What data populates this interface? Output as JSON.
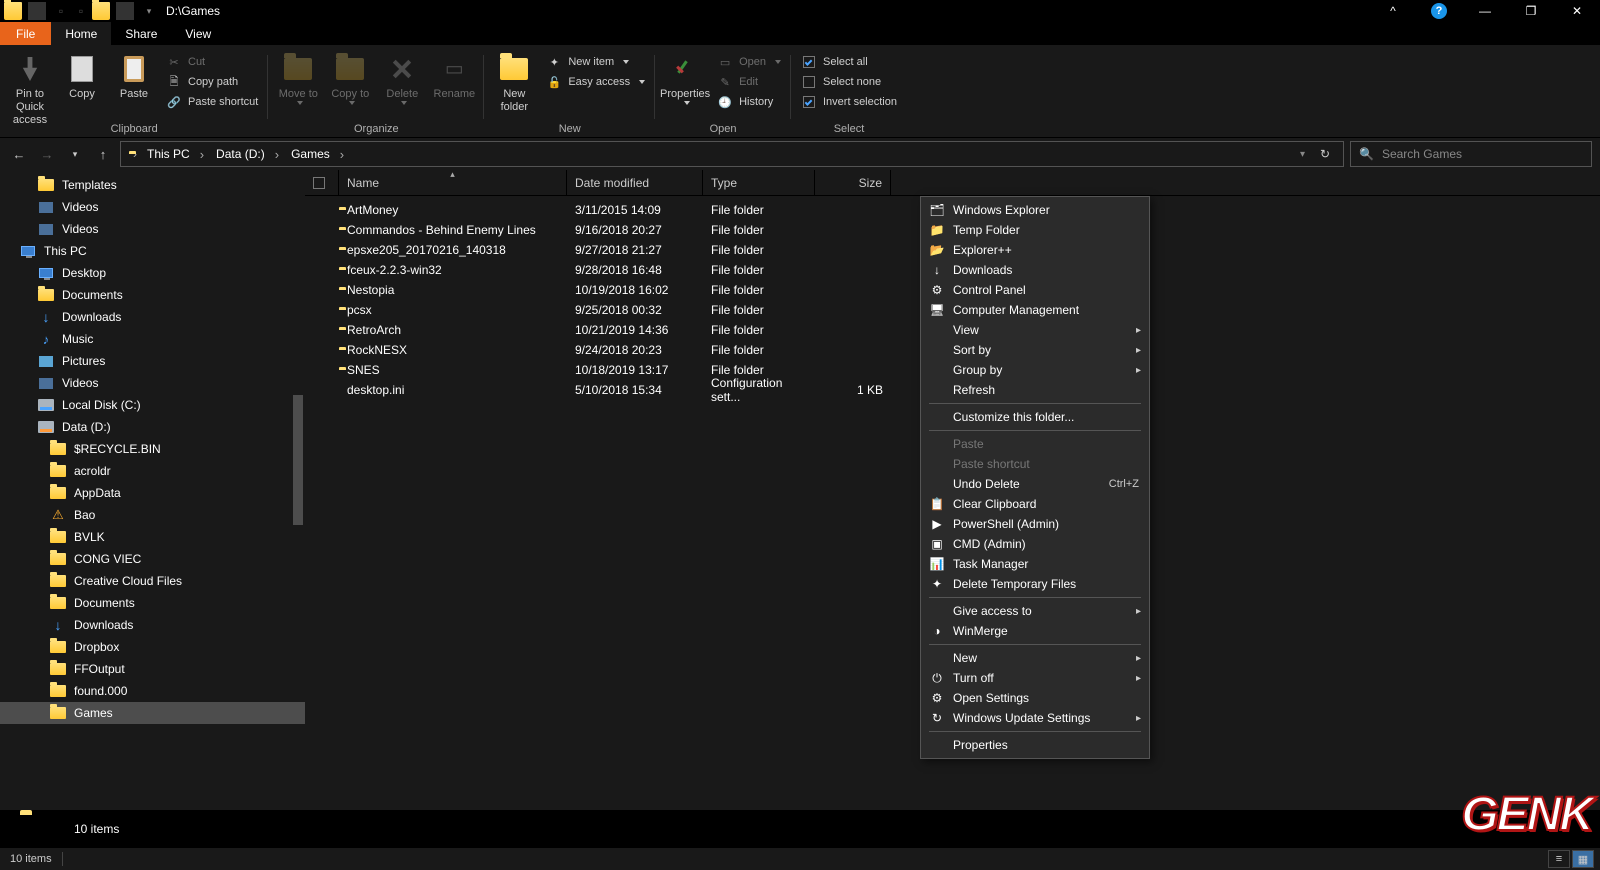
{
  "window": {
    "title": "D:\\Games"
  },
  "tabs": {
    "file": "File",
    "home": "Home",
    "share": "Share",
    "view": "View"
  },
  "ribbon": {
    "clipboard": {
      "label": "Clipboard",
      "pin": "Pin to Quick access",
      "copy": "Copy",
      "paste": "Paste",
      "cut": "Cut",
      "copypath": "Copy path",
      "pasteshortcut": "Paste shortcut"
    },
    "organize": {
      "label": "Organize",
      "moveto": "Move to",
      "copyto": "Copy to",
      "delete": "Delete",
      "rename": "Rename"
    },
    "new": {
      "label": "New",
      "newfolder": "New folder",
      "newitem": "New item",
      "easyaccess": "Easy access"
    },
    "open": {
      "label": "Open",
      "properties": "Properties",
      "open": "Open",
      "edit": "Edit",
      "history": "History"
    },
    "select": {
      "label": "Select",
      "selectall": "Select all",
      "selectnone": "Select none",
      "invert": "Invert selection"
    }
  },
  "breadcrumb": [
    "This PC",
    "Data (D:)",
    "Games"
  ],
  "search": {
    "placeholder": "Search Games"
  },
  "columns": {
    "name": "Name",
    "date": "Date modified",
    "type": "Type",
    "size": "Size"
  },
  "tree": [
    {
      "label": "Templates",
      "icon": "folder",
      "lvl": 1
    },
    {
      "label": "Videos",
      "icon": "vid",
      "lvl": 1
    },
    {
      "label": "Videos",
      "icon": "vid",
      "lvl": 1
    },
    {
      "label": "This PC",
      "icon": "monitor",
      "lvl": 0
    },
    {
      "label": "Desktop",
      "icon": "monitor",
      "lvl": 1
    },
    {
      "label": "Documents",
      "icon": "folder",
      "lvl": 1
    },
    {
      "label": "Downloads",
      "icon": "dl",
      "lvl": 1
    },
    {
      "label": "Music",
      "icon": "music",
      "lvl": 1
    },
    {
      "label": "Pictures",
      "icon": "pic",
      "lvl": 1
    },
    {
      "label": "Videos",
      "icon": "vid",
      "lvl": 1
    },
    {
      "label": "Local Disk (C:)",
      "icon": "disk",
      "lvl": 1
    },
    {
      "label": "Data (D:)",
      "icon": "disko",
      "lvl": 1
    },
    {
      "label": "$RECYCLE.BIN",
      "icon": "folder",
      "lvl": 2
    },
    {
      "label": "acroldr",
      "icon": "folder",
      "lvl": 2
    },
    {
      "label": "AppData",
      "icon": "folder",
      "lvl": 2
    },
    {
      "label": "Bao",
      "icon": "warn",
      "lvl": 2
    },
    {
      "label": "BVLK",
      "icon": "folder",
      "lvl": 2
    },
    {
      "label": "CONG VIEC",
      "icon": "folder",
      "lvl": 2
    },
    {
      "label": "Creative Cloud Files",
      "icon": "folder",
      "lvl": 2
    },
    {
      "label": "Documents",
      "icon": "folder",
      "lvl": 2
    },
    {
      "label": "Downloads",
      "icon": "dl",
      "lvl": 2
    },
    {
      "label": "Dropbox",
      "icon": "folder",
      "lvl": 2
    },
    {
      "label": "FFOutput",
      "icon": "folder",
      "lvl": 2
    },
    {
      "label": "found.000",
      "icon": "folder",
      "lvl": 2
    },
    {
      "label": "Games",
      "icon": "folder",
      "lvl": 2,
      "selected": true
    }
  ],
  "files": [
    {
      "name": "ArtMoney",
      "date": "3/11/2015 14:09",
      "type": "File folder",
      "size": "",
      "icon": "folder"
    },
    {
      "name": "Commandos - Behind Enemy Lines",
      "date": "9/16/2018 20:27",
      "type": "File folder",
      "size": "",
      "icon": "folder"
    },
    {
      "name": "epsxe205_20170216_140318",
      "date": "9/27/2018 21:27",
      "type": "File folder",
      "size": "",
      "icon": "folder"
    },
    {
      "name": "fceux-2.2.3-win32",
      "date": "9/28/2018 16:48",
      "type": "File folder",
      "size": "",
      "icon": "folder"
    },
    {
      "name": "Nestopia",
      "date": "10/19/2018 16:02",
      "type": "File folder",
      "size": "",
      "icon": "folder"
    },
    {
      "name": "pcsx",
      "date": "9/25/2018 00:32",
      "type": "File folder",
      "size": "",
      "icon": "folder"
    },
    {
      "name": "RetroArch",
      "date": "10/21/2019 14:36",
      "type": "File folder",
      "size": "",
      "icon": "folder"
    },
    {
      "name": "RockNESX",
      "date": "9/24/2018 20:23",
      "type": "File folder",
      "size": "",
      "icon": "folder"
    },
    {
      "name": "SNES",
      "date": "10/18/2019 13:17",
      "type": "File folder",
      "size": "",
      "icon": "folder"
    },
    {
      "name": "desktop.ini",
      "date": "5/10/2018 15:34",
      "type": "Configuration sett...",
      "size": "1 KB",
      "icon": "ini"
    }
  ],
  "context": [
    {
      "label": "Windows Explorer",
      "icon": "🗂"
    },
    {
      "label": "Temp Folder",
      "icon": "📁"
    },
    {
      "label": "Explorer++",
      "icon": "📂"
    },
    {
      "label": "Downloads",
      "icon": "↓"
    },
    {
      "label": "Control Panel",
      "icon": "⚙"
    },
    {
      "label": "Computer Management",
      "icon": "🖥"
    },
    {
      "label": "View",
      "sub": true
    },
    {
      "label": "Sort by",
      "sub": true
    },
    {
      "label": "Group by",
      "sub": true
    },
    {
      "label": "Refresh"
    },
    {
      "sep": true
    },
    {
      "label": "Customize this folder..."
    },
    {
      "sep": true
    },
    {
      "label": "Paste",
      "disabled": true
    },
    {
      "label": "Paste shortcut",
      "disabled": true
    },
    {
      "label": "Undo Delete",
      "shortcut": "Ctrl+Z"
    },
    {
      "label": "Clear Clipboard",
      "icon": "📋"
    },
    {
      "label": "PowerShell (Admin)",
      "icon": "▶"
    },
    {
      "label": "CMD (Admin)",
      "icon": "▣"
    },
    {
      "label": "Task Manager",
      "icon": "📊"
    },
    {
      "label": "Delete Temporary Files",
      "icon": "✦"
    },
    {
      "sep": true
    },
    {
      "label": "Give access to",
      "sub": true
    },
    {
      "label": "WinMerge",
      "icon": "◑"
    },
    {
      "sep": true
    },
    {
      "label": "New",
      "sub": true
    },
    {
      "label": "Turn off",
      "icon": "⏻",
      "sub": true
    },
    {
      "label": "Open Settings",
      "icon": "⚙"
    },
    {
      "label": "Windows Update Settings",
      "icon": "↻",
      "sub": true
    },
    {
      "sep": true
    },
    {
      "label": "Properties"
    }
  ],
  "status": {
    "items_upper": "10 items",
    "items_lower": "10 items"
  },
  "watermark": "GENK"
}
